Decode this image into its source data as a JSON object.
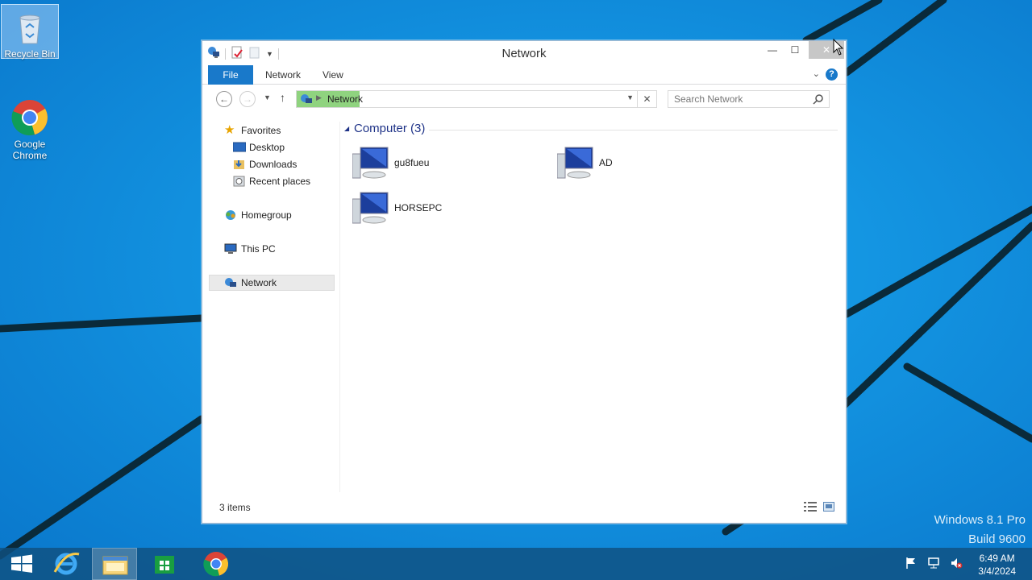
{
  "desktop": {
    "icons": [
      {
        "label": "Recycle Bin"
      },
      {
        "label": "Google Chrome"
      }
    ],
    "watermark": {
      "line1": "Windows 8.1 Pro",
      "line2": "Build 9600"
    }
  },
  "window": {
    "title": "Network",
    "controls": {
      "minimize": "—",
      "maximize": "☐",
      "close": "✕"
    },
    "ribbon_tabs": [
      "File",
      "Network",
      "View"
    ],
    "help": "?",
    "address": {
      "location": "Network"
    },
    "search": {
      "placeholder": "Search Network"
    },
    "nav": {
      "favorites": "Favorites",
      "desktop": "Desktop",
      "downloads": "Downloads",
      "recent": "Recent places",
      "homegroup": "Homegroup",
      "this_pc": "This PC",
      "network": "Network"
    },
    "group": {
      "label": "Computer (3)"
    },
    "items": [
      "gu8fueu",
      "AD",
      "HORSEPC"
    ],
    "status": "3 items"
  },
  "taskbar": {
    "clock": {
      "time": "6:49 AM",
      "date": "3/4/2024"
    }
  },
  "colors": {
    "desktop": "#1593e0",
    "accent": "#1979ca",
    "address_highlight": "#8fd37f"
  }
}
